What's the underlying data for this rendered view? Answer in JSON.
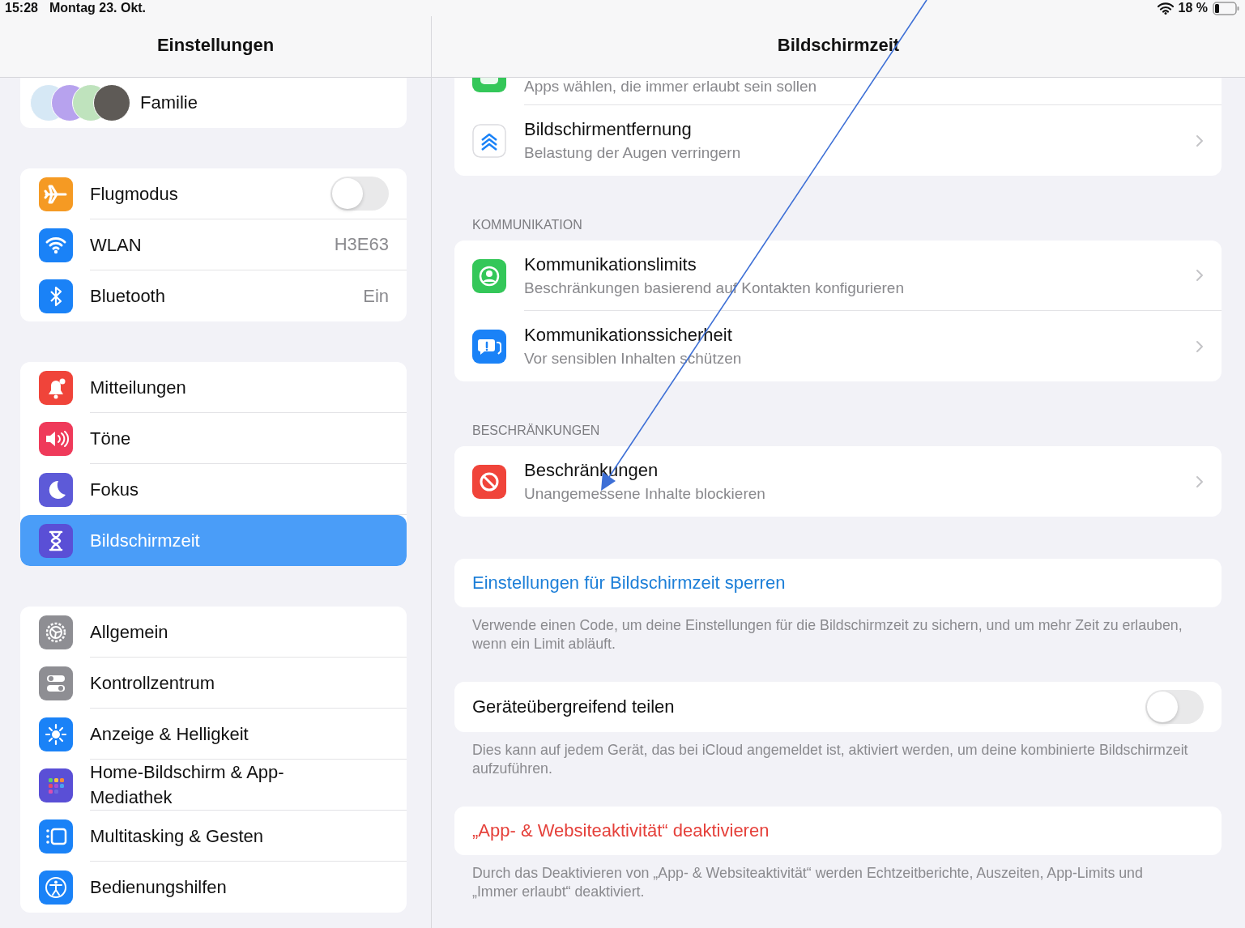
{
  "status_bar": {
    "time": "15:28",
    "date": "Montag 23. Okt.",
    "battery": "18 %"
  },
  "sidebar": {
    "title": "Einstellungen",
    "family": {
      "label": "Familie",
      "avatars": [
        {
          "color": "#d6e8f5"
        },
        {
          "color": "#b7a2ee"
        },
        {
          "color": "#bfe3bd"
        },
        {
          "color": "#5e5a56"
        }
      ]
    },
    "groups": [
      {
        "items": [
          {
            "label": "Flugmodus",
            "kind": "toggle",
            "on": false,
            "color": "#f59a23",
            "selected": false
          },
          {
            "label": "WLAN",
            "kind": "value",
            "value": "H3E63",
            "color": "#1a82f7",
            "selected": false
          },
          {
            "label": "Bluetooth",
            "kind": "value",
            "value": "Ein",
            "color": "#1a82f7",
            "selected": false
          }
        ]
      },
      {
        "items": [
          {
            "label": "Mitteilungen",
            "kind": "link",
            "color": "#f0443a",
            "selected": false
          },
          {
            "label": "Töne",
            "kind": "link",
            "color": "#ef3a5a",
            "selected": false
          },
          {
            "label": "Fokus",
            "kind": "link",
            "color": "#5d5ad8",
            "selected": false
          },
          {
            "label": "Bildschirmzeit",
            "kind": "link",
            "color": "#5a4fd6",
            "selected": true
          }
        ]
      },
      {
        "items": [
          {
            "label": "Allgemein",
            "kind": "link",
            "color": "#8e8e93",
            "selected": false
          },
          {
            "label": "Kontrollzentrum",
            "kind": "link",
            "color": "#8e8e93",
            "selected": false
          },
          {
            "label": "Anzeige & Helligkeit",
            "kind": "link",
            "color": "#1a82f7",
            "selected": false
          },
          {
            "label": "Home-Bildschirm & App-Mediathek",
            "kind": "link",
            "color": "#5a4fd6",
            "selected": false
          },
          {
            "label": "Multitasking & Gesten",
            "kind": "link",
            "color": "#1a82f7",
            "selected": false
          },
          {
            "label": "Bedienungshilfen",
            "kind": "link",
            "color": "#1a82f7",
            "selected": false
          }
        ]
      }
    ]
  },
  "detail": {
    "title": "Bildschirmzeit",
    "sections": [
      {
        "kind": "list",
        "rows": [
          {
            "subtitle": "Apps wählen, die immer erlaubt sein sollen",
            "color": "#34c759"
          },
          {
            "title": "Bildschirmentfernung",
            "subtitle": "Belastung der Augen verringern",
            "color": "#ffffff"
          }
        ]
      },
      {
        "kind": "list",
        "heading": "KOMMUNIKATION",
        "rows": [
          {
            "title": "Kommunikationslimits",
            "subtitle": "Beschränkungen basierend auf Kontakten konfigurieren",
            "color": "#34c759"
          },
          {
            "title": "Kommunikationssicherheit",
            "subtitle": "Vor sensiblen Inhalten schützen",
            "color": "#1a82f7"
          }
        ]
      },
      {
        "kind": "list",
        "heading": "BESCHRÄNKUNGEN",
        "rows": [
          {
            "title": "Beschränkungen",
            "subtitle": "Unangemessene Inhalte blockieren",
            "color": "#f0443a"
          }
        ]
      },
      {
        "kind": "link",
        "label": "Einstellungen für Bildschirmzeit sperren",
        "footer": "Verwende einen Code, um deine Einstellungen für die Bildschirmzeit zu sichern, und um mehr Zeit zu erlauben, wenn ein Limit abläuft."
      },
      {
        "kind": "toggle",
        "label": "Geräteübergreifend teilen",
        "on": false,
        "footer": "Dies kann auf jedem Gerät, das bei iCloud angemeldet ist, aktiviert werden, um deine kombinierte Bildschirmzeit aufzuführen."
      },
      {
        "kind": "destructive",
        "label": "„App- & Websiteaktivität“ deaktivieren",
        "footer": "Durch das Deaktivieren von „App- & Websiteaktivität“ werden Echtzeitberichte, Auszeiten, App-Limits und „Immer erlaubt“ deaktiviert."
      }
    ]
  }
}
